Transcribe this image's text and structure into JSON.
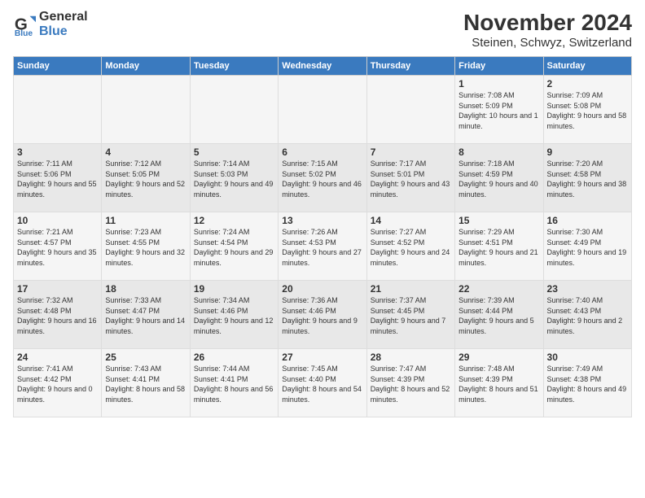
{
  "logo": {
    "general": "General",
    "blue": "Blue"
  },
  "title": "November 2024",
  "subtitle": "Steinen, Schwyz, Switzerland",
  "headers": [
    "Sunday",
    "Monday",
    "Tuesday",
    "Wednesday",
    "Thursday",
    "Friday",
    "Saturday"
  ],
  "weeks": [
    [
      {
        "day": "",
        "info": ""
      },
      {
        "day": "",
        "info": ""
      },
      {
        "day": "",
        "info": ""
      },
      {
        "day": "",
        "info": ""
      },
      {
        "day": "",
        "info": ""
      },
      {
        "day": "1",
        "info": "Sunrise: 7:08 AM\nSunset: 5:09 PM\nDaylight: 10 hours and 1 minute."
      },
      {
        "day": "2",
        "info": "Sunrise: 7:09 AM\nSunset: 5:08 PM\nDaylight: 9 hours and 58 minutes."
      }
    ],
    [
      {
        "day": "3",
        "info": "Sunrise: 7:11 AM\nSunset: 5:06 PM\nDaylight: 9 hours and 55 minutes."
      },
      {
        "day": "4",
        "info": "Sunrise: 7:12 AM\nSunset: 5:05 PM\nDaylight: 9 hours and 52 minutes."
      },
      {
        "day": "5",
        "info": "Sunrise: 7:14 AM\nSunset: 5:03 PM\nDaylight: 9 hours and 49 minutes."
      },
      {
        "day": "6",
        "info": "Sunrise: 7:15 AM\nSunset: 5:02 PM\nDaylight: 9 hours and 46 minutes."
      },
      {
        "day": "7",
        "info": "Sunrise: 7:17 AM\nSunset: 5:01 PM\nDaylight: 9 hours and 43 minutes."
      },
      {
        "day": "8",
        "info": "Sunrise: 7:18 AM\nSunset: 4:59 PM\nDaylight: 9 hours and 40 minutes."
      },
      {
        "day": "9",
        "info": "Sunrise: 7:20 AM\nSunset: 4:58 PM\nDaylight: 9 hours and 38 minutes."
      }
    ],
    [
      {
        "day": "10",
        "info": "Sunrise: 7:21 AM\nSunset: 4:57 PM\nDaylight: 9 hours and 35 minutes."
      },
      {
        "day": "11",
        "info": "Sunrise: 7:23 AM\nSunset: 4:55 PM\nDaylight: 9 hours and 32 minutes."
      },
      {
        "day": "12",
        "info": "Sunrise: 7:24 AM\nSunset: 4:54 PM\nDaylight: 9 hours and 29 minutes."
      },
      {
        "day": "13",
        "info": "Sunrise: 7:26 AM\nSunset: 4:53 PM\nDaylight: 9 hours and 27 minutes."
      },
      {
        "day": "14",
        "info": "Sunrise: 7:27 AM\nSunset: 4:52 PM\nDaylight: 9 hours and 24 minutes."
      },
      {
        "day": "15",
        "info": "Sunrise: 7:29 AM\nSunset: 4:51 PM\nDaylight: 9 hours and 21 minutes."
      },
      {
        "day": "16",
        "info": "Sunrise: 7:30 AM\nSunset: 4:49 PM\nDaylight: 9 hours and 19 minutes."
      }
    ],
    [
      {
        "day": "17",
        "info": "Sunrise: 7:32 AM\nSunset: 4:48 PM\nDaylight: 9 hours and 16 minutes."
      },
      {
        "day": "18",
        "info": "Sunrise: 7:33 AM\nSunset: 4:47 PM\nDaylight: 9 hours and 14 minutes."
      },
      {
        "day": "19",
        "info": "Sunrise: 7:34 AM\nSunset: 4:46 PM\nDaylight: 9 hours and 12 minutes."
      },
      {
        "day": "20",
        "info": "Sunrise: 7:36 AM\nSunset: 4:46 PM\nDaylight: 9 hours and 9 minutes."
      },
      {
        "day": "21",
        "info": "Sunrise: 7:37 AM\nSunset: 4:45 PM\nDaylight: 9 hours and 7 minutes."
      },
      {
        "day": "22",
        "info": "Sunrise: 7:39 AM\nSunset: 4:44 PM\nDaylight: 9 hours and 5 minutes."
      },
      {
        "day": "23",
        "info": "Sunrise: 7:40 AM\nSunset: 4:43 PM\nDaylight: 9 hours and 2 minutes."
      }
    ],
    [
      {
        "day": "24",
        "info": "Sunrise: 7:41 AM\nSunset: 4:42 PM\nDaylight: 9 hours and 0 minutes."
      },
      {
        "day": "25",
        "info": "Sunrise: 7:43 AM\nSunset: 4:41 PM\nDaylight: 8 hours and 58 minutes."
      },
      {
        "day": "26",
        "info": "Sunrise: 7:44 AM\nSunset: 4:41 PM\nDaylight: 8 hours and 56 minutes."
      },
      {
        "day": "27",
        "info": "Sunrise: 7:45 AM\nSunset: 4:40 PM\nDaylight: 8 hours and 54 minutes."
      },
      {
        "day": "28",
        "info": "Sunrise: 7:47 AM\nSunset: 4:39 PM\nDaylight: 8 hours and 52 minutes."
      },
      {
        "day": "29",
        "info": "Sunrise: 7:48 AM\nSunset: 4:39 PM\nDaylight: 8 hours and 51 minutes."
      },
      {
        "day": "30",
        "info": "Sunrise: 7:49 AM\nSunset: 4:38 PM\nDaylight: 8 hours and 49 minutes."
      }
    ]
  ]
}
